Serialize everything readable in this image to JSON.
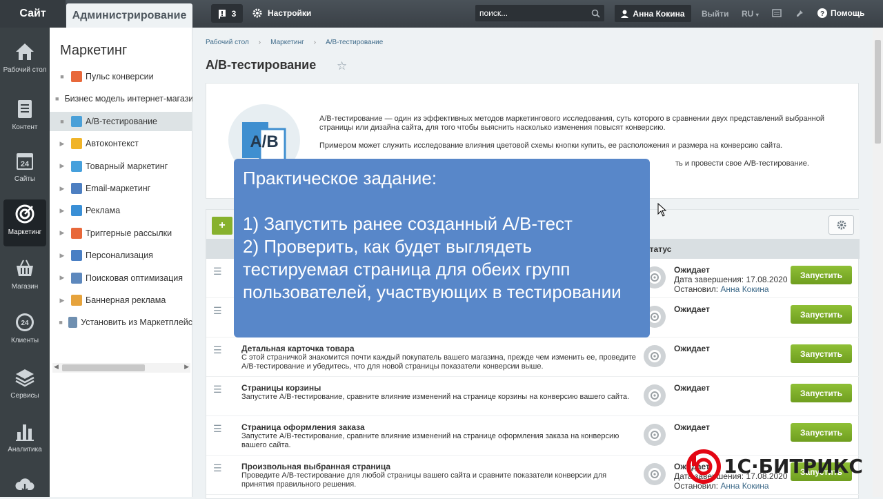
{
  "topbar": {
    "site": "Сайт",
    "admin": "Администрирование",
    "notifications": "3",
    "settings": "Настройки",
    "search_placeholder": "поиск...",
    "user": "Анна Кокина",
    "logout": "Выйти",
    "lang": "RU",
    "help": "Помощь"
  },
  "leftnav": [
    {
      "label": "Рабочий стол",
      "icon": "home-icon"
    },
    {
      "label": "Контент",
      "icon": "document-icon"
    },
    {
      "label": "Сайты",
      "icon": "calendar-24-icon"
    },
    {
      "label": "Маркетинг",
      "icon": "target-icon",
      "active": true
    },
    {
      "label": "Магазин",
      "icon": "basket-icon"
    },
    {
      "label": "Клиенты",
      "icon": "clients-24-icon"
    },
    {
      "label": "Сервисы",
      "icon": "layers-icon"
    },
    {
      "label": "Аналитика",
      "icon": "analytics-icon"
    }
  ],
  "sidepanel": {
    "title": "Маркетинг",
    "items": [
      {
        "label": "Пульс конверсии",
        "color": "#e8683a",
        "expandable": false
      },
      {
        "label": "Бизнес модель интернет-магазина",
        "color": "#3aa1d8",
        "expandable": false
      },
      {
        "label": "A/B-тестирование",
        "color": "#4aa0d8",
        "expandable": false,
        "active": true
      },
      {
        "label": "Автоконтекст",
        "color": "#f0b429",
        "expandable": true
      },
      {
        "label": "Товарный маркетинг",
        "color": "#46a0dc",
        "expandable": true
      },
      {
        "label": "Email-маркетинг",
        "color": "#4d7fc1",
        "expandable": true
      },
      {
        "label": "Реклама",
        "color": "#3a8fd6",
        "expandable": true
      },
      {
        "label": "Триггерные рассылки",
        "color": "#e8683a",
        "expandable": true
      },
      {
        "label": "Персонализация",
        "color": "#4a7fc4",
        "expandable": true
      },
      {
        "label": "Поисковая оптимизация",
        "color": "#5d88bd",
        "expandable": true
      },
      {
        "label": "Баннерная реклама",
        "color": "#e6a33c",
        "expandable": true
      },
      {
        "label": "Установить из Маркетплейс",
        "color": "#6f8fb0",
        "expandable": false
      }
    ]
  },
  "breadcrumbs": [
    "Рабочий стол",
    "Маркетинг",
    "A/B-тестирование"
  ],
  "page_title": "A/B-тестирование",
  "intro": {
    "logo_text": "A/B",
    "p1": "A/B-тестирование — один из эффективных методов маркетингового исследования, суть которого в сравнении двух представлений выбранной страницы или дизайна сайта, для того чтобы выяснить насколько изменения повысят конверсию.",
    "p2": "Примером может служить исследование влияния цветовой схемы кнопки купить, ее расположения и размера на конверсию сайта.",
    "p3_fragment": "ть и провести свое A/B-тестирование."
  },
  "grid": {
    "add_label": "+",
    "status_header": "Статус",
    "rows": [
      {
        "title": "",
        "desc": "",
        "status": "Ожидает",
        "line1": "Дата завершения: 17.08.2020",
        "line2_prefix": "Остановил: ",
        "line2_link": "Анна Кокина",
        "run": "Запустить"
      },
      {
        "title": "",
        "desc": "",
        "status": "Ожидает",
        "line1": "",
        "line2_prefix": "",
        "line2_link": "",
        "run": "Запустить"
      },
      {
        "title": "Детальная карточка товара",
        "desc": "С этой страничкой знакомится почти каждый покупатель вашего магазина, прежде чем изменить ее, проведите A/B-тестирование и убедитесь, что для новой страницы показатели конверсии выше.",
        "status": "Ожидает",
        "line1": "",
        "line2_prefix": "",
        "line2_link": "",
        "run": "Запустить"
      },
      {
        "title": "Страницы корзины",
        "desc": "Запустите A/B-тестирование, сравните влияние изменений на странице корзины на конверсию вашего сайта.",
        "status": "Ожидает",
        "line1": "",
        "line2_prefix": "",
        "line2_link": "",
        "run": "Запустить"
      },
      {
        "title": "Страница оформления заказа",
        "desc": "Запустите A/B-тестирование, сравните влияние изменений на странице оформления заказа на конверсию вашего сайта.",
        "status": "Ожидает",
        "line1": "",
        "line2_prefix": "",
        "line2_link": "",
        "run": "Запустить"
      },
      {
        "title": "Произвольная выбранная страница",
        "desc": "Проведите A/B-тестирование для любой страницы вашего сайта и сравните показатели конверсии для принятия правильного решения.",
        "status": "Ожидает",
        "line1": "Дата завершения: 17.08.2020",
        "line2_prefix": "Остановил: ",
        "line2_link": "Анна Кокина",
        "run": "Запустить"
      }
    ]
  },
  "overlay": {
    "title": "Практическое задание:",
    "line1": "1) Запустить ранее созданный A/B-тест",
    "line2": "2) Проверить, как будет выглядеть тестируемая страница для обеих групп пользователей, участвующих в тестировании"
  },
  "brand": {
    "text": "1С·БИТРИКС",
    "color": "#e30613"
  }
}
